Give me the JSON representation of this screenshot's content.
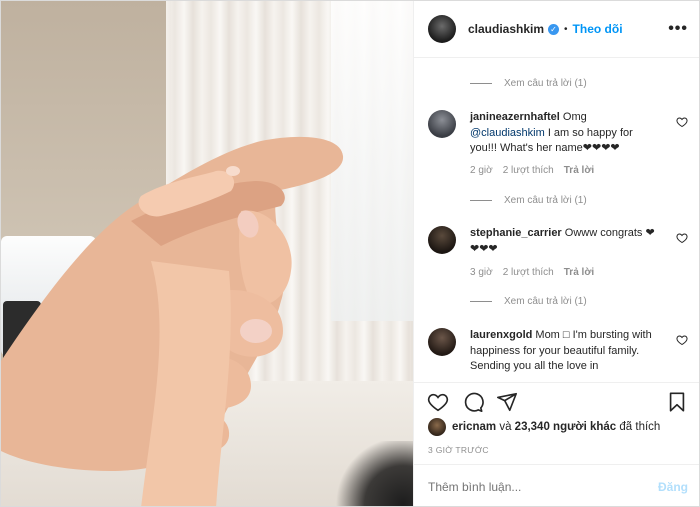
{
  "header": {
    "username": "claudiashkim",
    "follow_label": "Theo dõi",
    "more_label": "•••"
  },
  "replies_label": "Xem câu trả lời (1)",
  "comments": [
    {
      "username": "janineazernhaftel",
      "text_pre": "Omg",
      "mention": "@claudiashkim",
      "text_post": "I am so happy for you!!! What's her name❤❤❤❤",
      "time": "2 giờ",
      "likes": "2 lượt thích",
      "reply": "Trả lời"
    },
    {
      "username": "stephanie_carrier",
      "text": "Owww congrats ❤❤❤❤",
      "time": "3 giờ",
      "likes": "2 lượt thích",
      "reply": "Trả lời"
    },
    {
      "username": "laurenxgold",
      "text": "Mom □ I'm bursting with happiness for your beautiful family. Sending you all the love in"
    }
  ],
  "likes": {
    "user": "ericnam",
    "connector": "và",
    "others": "23,340 người khác",
    "suffix": "đã thích"
  },
  "time_ago": "3 GIỜ TRƯỚC",
  "add_comment": {
    "placeholder": "Thêm bình luận...",
    "post_label": "Đăng"
  },
  "icons": [
    "heart-icon",
    "comment-icon",
    "share-icon",
    "bookmark-icon",
    "more-icon",
    "verified-icon"
  ],
  "colors": {
    "accent": "#0095f6",
    "verified": "#3897f0",
    "muted": "#8e8e8e"
  }
}
